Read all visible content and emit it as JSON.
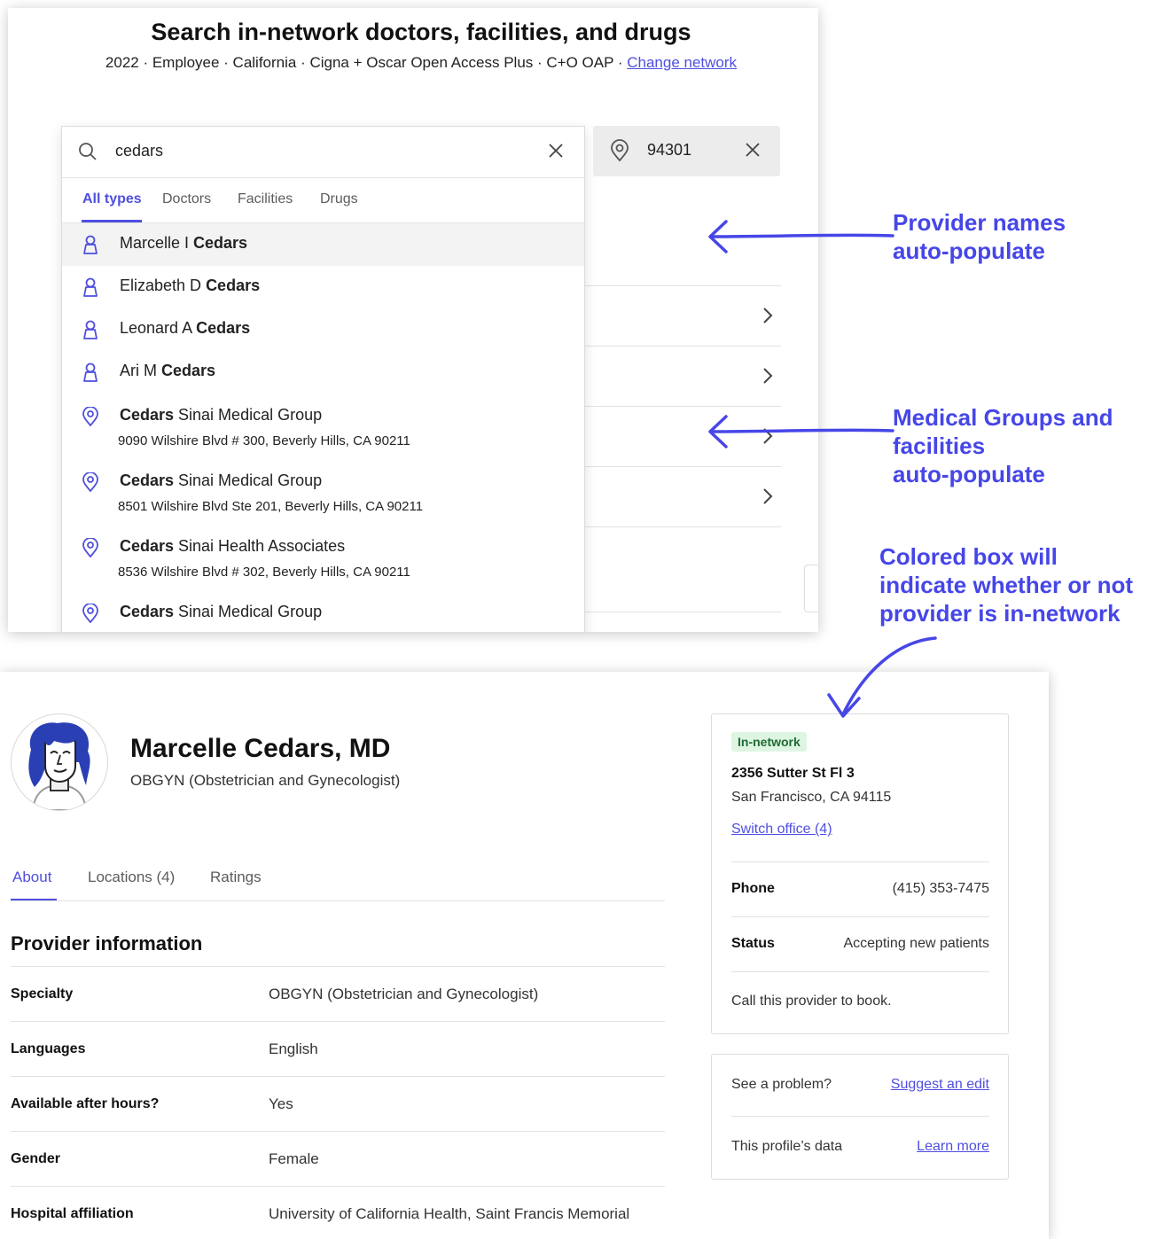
{
  "search_page": {
    "title": "Search in-network doctors, facilities, and drugs",
    "subtitle": "2022 · Employee · California · Cigna + Oscar Open Access Plus · C+O OAP · ",
    "change_network": "Change network",
    "search_value": "cedars",
    "zip_value": "94301",
    "tabs": [
      "All types",
      "Doctors",
      "Facilities",
      "Drugs"
    ],
    "active_tab": "All types",
    "results": [
      {
        "type": "person",
        "prefix": "Marcelle I ",
        "match": "Cedars",
        "suffix": "",
        "address": ""
      },
      {
        "type": "person",
        "prefix": "Elizabeth D ",
        "match": "Cedars",
        "suffix": "",
        "address": ""
      },
      {
        "type": "person",
        "prefix": "Leonard A ",
        "match": "Cedars",
        "suffix": "",
        "address": ""
      },
      {
        "type": "person",
        "prefix": "Ari M ",
        "match": "Cedars",
        "suffix": "",
        "address": ""
      },
      {
        "type": "place",
        "prefix": "",
        "match": "Cedars",
        "suffix": " Sinai Medical Group",
        "address": "9090 Wilshire Blvd # 300, Beverly Hills, CA 90211"
      },
      {
        "type": "place",
        "prefix": "",
        "match": "Cedars",
        "suffix": " Sinai Medical Group",
        "address": "8501 Wilshire Blvd Ste 201, Beverly Hills, CA 90211"
      },
      {
        "type": "place",
        "prefix": "",
        "match": "Cedars",
        "suffix": " Sinai Health Associates",
        "address": "8536 Wilshire Blvd # 302, Beverly Hills, CA 90211"
      },
      {
        "type": "place",
        "prefix": "",
        "match": "Cedars",
        "suffix": " Sinai Medical Group",
        "address": ""
      }
    ]
  },
  "annotations": {
    "provider_names": [
      "Provider names",
      "auto-populate"
    ],
    "medical_groups": [
      "Medical Groups and",
      "facilities",
      "auto-populate"
    ],
    "colored_box": [
      "Colored box will",
      "indicate whether or not",
      "provider is in-network"
    ],
    "color": "#4646e8"
  },
  "profile": {
    "name": "Marcelle Cedars, MD",
    "specialty": "OBGYN (Obstetrician and Gynecologist)",
    "tabs": [
      "About",
      "Locations (4)",
      "Ratings"
    ],
    "active_tab": "About",
    "section_title": "Provider information",
    "info_rows": [
      {
        "label": "Specialty",
        "value": "OBGYN (Obstetrician and Gynecologist)"
      },
      {
        "label": "Languages",
        "value": "English"
      },
      {
        "label": "Available after hours?",
        "value": "Yes"
      },
      {
        "label": "Gender",
        "value": "Female"
      },
      {
        "label": "Hospital affiliation",
        "value": "University of California Health, Saint Francis Memorial"
      }
    ],
    "office_card": {
      "badge": "In-network",
      "badge_color": "#def5e2",
      "address_line1": "2356 Sutter St Fl 3",
      "address_line2": "San Francisco, CA 94115",
      "switch_office": "Switch office (4)",
      "phone_label": "Phone",
      "phone_value": "(415) 353-7475",
      "status_label": "Status",
      "status_value": "Accepting new patients",
      "call_note": "Call this provider to book."
    },
    "problem_card": {
      "problem_text": "See a problem?",
      "suggest_link": "Suggest an edit",
      "data_text": "This profile’s data",
      "learn_link": "Learn more"
    }
  },
  "accent_color": "#4f4fe0"
}
